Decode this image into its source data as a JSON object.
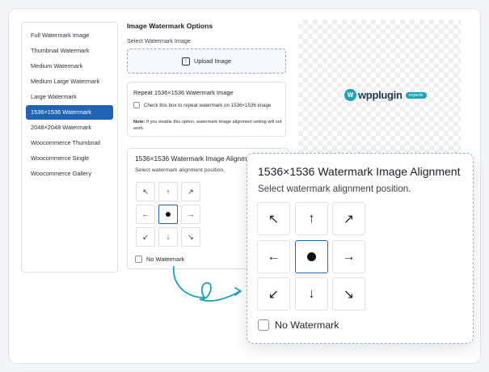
{
  "sidebar": {
    "items": [
      {
        "label": "Full Watermark Image",
        "active": false
      },
      {
        "label": "Thumbnail Watermark",
        "active": false
      },
      {
        "label": "Medium Watermark",
        "active": false
      },
      {
        "label": "Medium Large Watermark",
        "active": false
      },
      {
        "label": "Large Watermark",
        "active": false
      },
      {
        "label": "1536×1536 Watermark",
        "active": true
      },
      {
        "label": "2048×2048 Watermark",
        "active": false
      },
      {
        "label": "Woocommerce Thumbnail",
        "active": false
      },
      {
        "label": "Woocommerce Single",
        "active": false
      },
      {
        "label": "Woocommerce Gallery",
        "active": false
      }
    ]
  },
  "main": {
    "title": "Image Watermark Options",
    "select_label": "Select Watermark Image",
    "upload_button": "Upload Image",
    "repeat": {
      "title": "Repeat 1536×1536 Watermark Image",
      "checkbox_label": "Check this box to repeat watermark on 1536×1536 image",
      "note_bold": "Note:",
      "note_text": " If you enable this option, watermark image alignment setting will not work."
    },
    "alignment": {
      "title": "1536×1536 Watermark Image Alignment",
      "subtitle": "Select watermark alignment position.",
      "no_watermark": "No Watermark",
      "selected": "center"
    }
  },
  "preview": {
    "logo_mark": "W",
    "logo_text": "wpplugin",
    "logo_badge": "experts",
    "brand_color": "#1aa3b8",
    "logo_text_color": "#1a3a5c"
  },
  "zoom": {
    "title": "1536×1536 Watermark Image Alignment",
    "subtitle": "Select watermark alignment position.",
    "no_watermark": "No Watermark"
  },
  "arrows": {
    "top_left": "↖",
    "top": "↑",
    "top_right": "↗",
    "left": "←",
    "right": "→",
    "bottom_left": "↙",
    "bottom": "↓",
    "bottom_right": "↘"
  },
  "colors": {
    "accent": "#1f64b5",
    "connector": "#1aa3b8"
  }
}
